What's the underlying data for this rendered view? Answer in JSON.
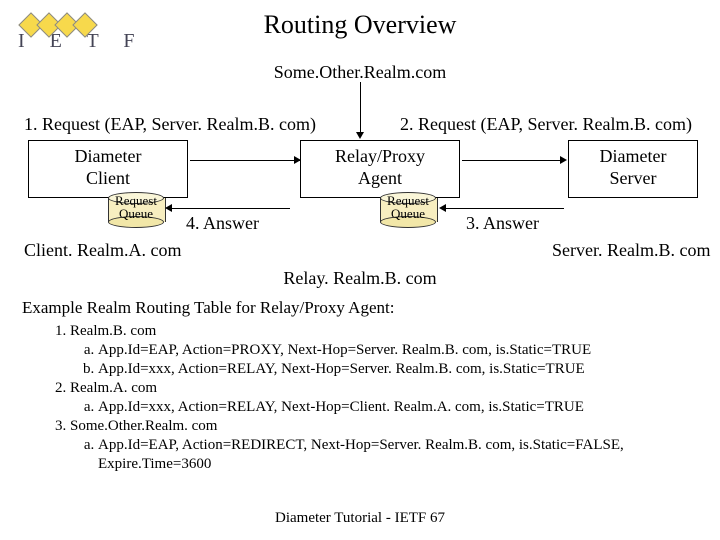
{
  "title": "Routing Overview",
  "logo": {
    "letters": "I E T F"
  },
  "top_realm": "Some.Other.Realm.com",
  "req1": "1. Request (EAP, Server. Realm.B. com)",
  "req2": "2. Request (EAP, Server. Realm.B. com)",
  "nodes": {
    "client": "Diameter\nClient",
    "relay": "Relay/Proxy\nAgent",
    "server": "Diameter\nServer"
  },
  "queues": {
    "client": "Request\nQueue",
    "relay": "Request\nQueue"
  },
  "ans4": "4. Answer",
  "ans3": "3. Answer",
  "fqdn": {
    "client": "Client. Realm.A. com",
    "relay": "Relay. Realm.B. com",
    "server": "Server. Realm.B. com"
  },
  "table_header": "Example Realm Routing Table for Relay/Proxy Agent:",
  "routes": [
    {
      "realm": "Realm.B. com",
      "rules": [
        "App.Id=EAP, Action=PROXY, Next-Hop=Server. Realm.B. com, is.Static=TRUE",
        "App.Id=xxx, Action=RELAY, Next-Hop=Server. Realm.B. com, is.Static=TRUE"
      ]
    },
    {
      "realm": "Realm.A. com",
      "rules": [
        "App.Id=xxx, Action=RELAY, Next-Hop=Client. Realm.A. com, is.Static=TRUE"
      ]
    },
    {
      "realm": "Some.Other.Realm. com",
      "rules": [
        "App.Id=EAP, Action=REDIRECT, Next-Hop=Server. Realm.B. com, is.Static=FALSE, Expire.Time=3600"
      ]
    }
  ],
  "footer": "Diameter Tutorial - IETF 67"
}
